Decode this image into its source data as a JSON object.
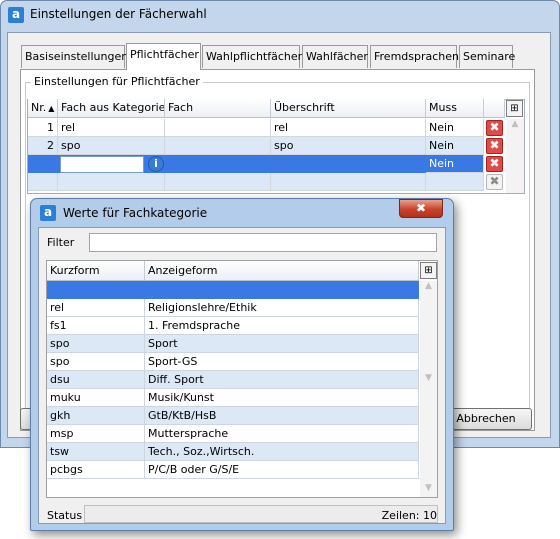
{
  "main_window": {
    "title": "Einstellungen der Fächerwahl",
    "tabs": [
      {
        "label": "Basiseinstellungen"
      },
      {
        "label": "Pflichtfächer"
      },
      {
        "label": "Wahlpflichtfächer"
      },
      {
        "label": "Wahlfächer"
      },
      {
        "label": "Fremdsprachen"
      },
      {
        "label": "Seminare"
      }
    ],
    "active_tab": "Pflichtfächer",
    "group_title": "Einstellungen für Pflichtfächer",
    "grid": {
      "columns": [
        "Nr.",
        "Fach aus Kategorie",
        "Fach",
        "Überschrift",
        "Muss"
      ],
      "sort_indicator": "▲",
      "rows": [
        {
          "nr": "1",
          "kategorie": "rel",
          "fach": "",
          "ueberschrift": "rel",
          "muss": "Nein"
        },
        {
          "nr": "2",
          "kategorie": "spo",
          "fach": "",
          "ueberschrift": "spo",
          "muss": "Nein"
        },
        {
          "nr": "",
          "kategorie": "",
          "fach": "",
          "ueberschrift": "",
          "muss": "Nein"
        }
      ],
      "delete_glyph": "✖"
    },
    "cancel_button": "Abbrechen"
  },
  "popup": {
    "title": "Werte für Fachkategorie",
    "close_glyph": "✖",
    "filter_label": "Filter",
    "filter_value": "",
    "columns": [
      "Kurzform",
      "Anzeigeform"
    ],
    "rows": [
      {
        "kurz": "",
        "anzeige": ""
      },
      {
        "kurz": "rel",
        "anzeige": "Religionslehre/Ethik"
      },
      {
        "kurz": "fs1",
        "anzeige": "1. Fremdsprache"
      },
      {
        "kurz": "spo",
        "anzeige": "Sport"
      },
      {
        "kurz": "spo",
        "anzeige": "Sport-GS"
      },
      {
        "kurz": "dsu",
        "anzeige": "Diff. Sport"
      },
      {
        "kurz": "muku",
        "anzeige": "Musik/Kunst"
      },
      {
        "kurz": "gkh",
        "anzeige": "GtB/KtB/HsB"
      },
      {
        "kurz": "msp",
        "anzeige": "Muttersprache"
      },
      {
        "kurz": "tsw",
        "anzeige": "Tech., Soz.,Wirtsch."
      },
      {
        "kurz": "pcbgs",
        "anzeige": "P/C/B oder G/S/E"
      }
    ],
    "status_label": "Status",
    "row_count": "Zeilen: 10"
  },
  "colors": {
    "selection": "#3a79e4",
    "alt_row": "#dce8f6",
    "delete_red": "#e24a4a"
  }
}
